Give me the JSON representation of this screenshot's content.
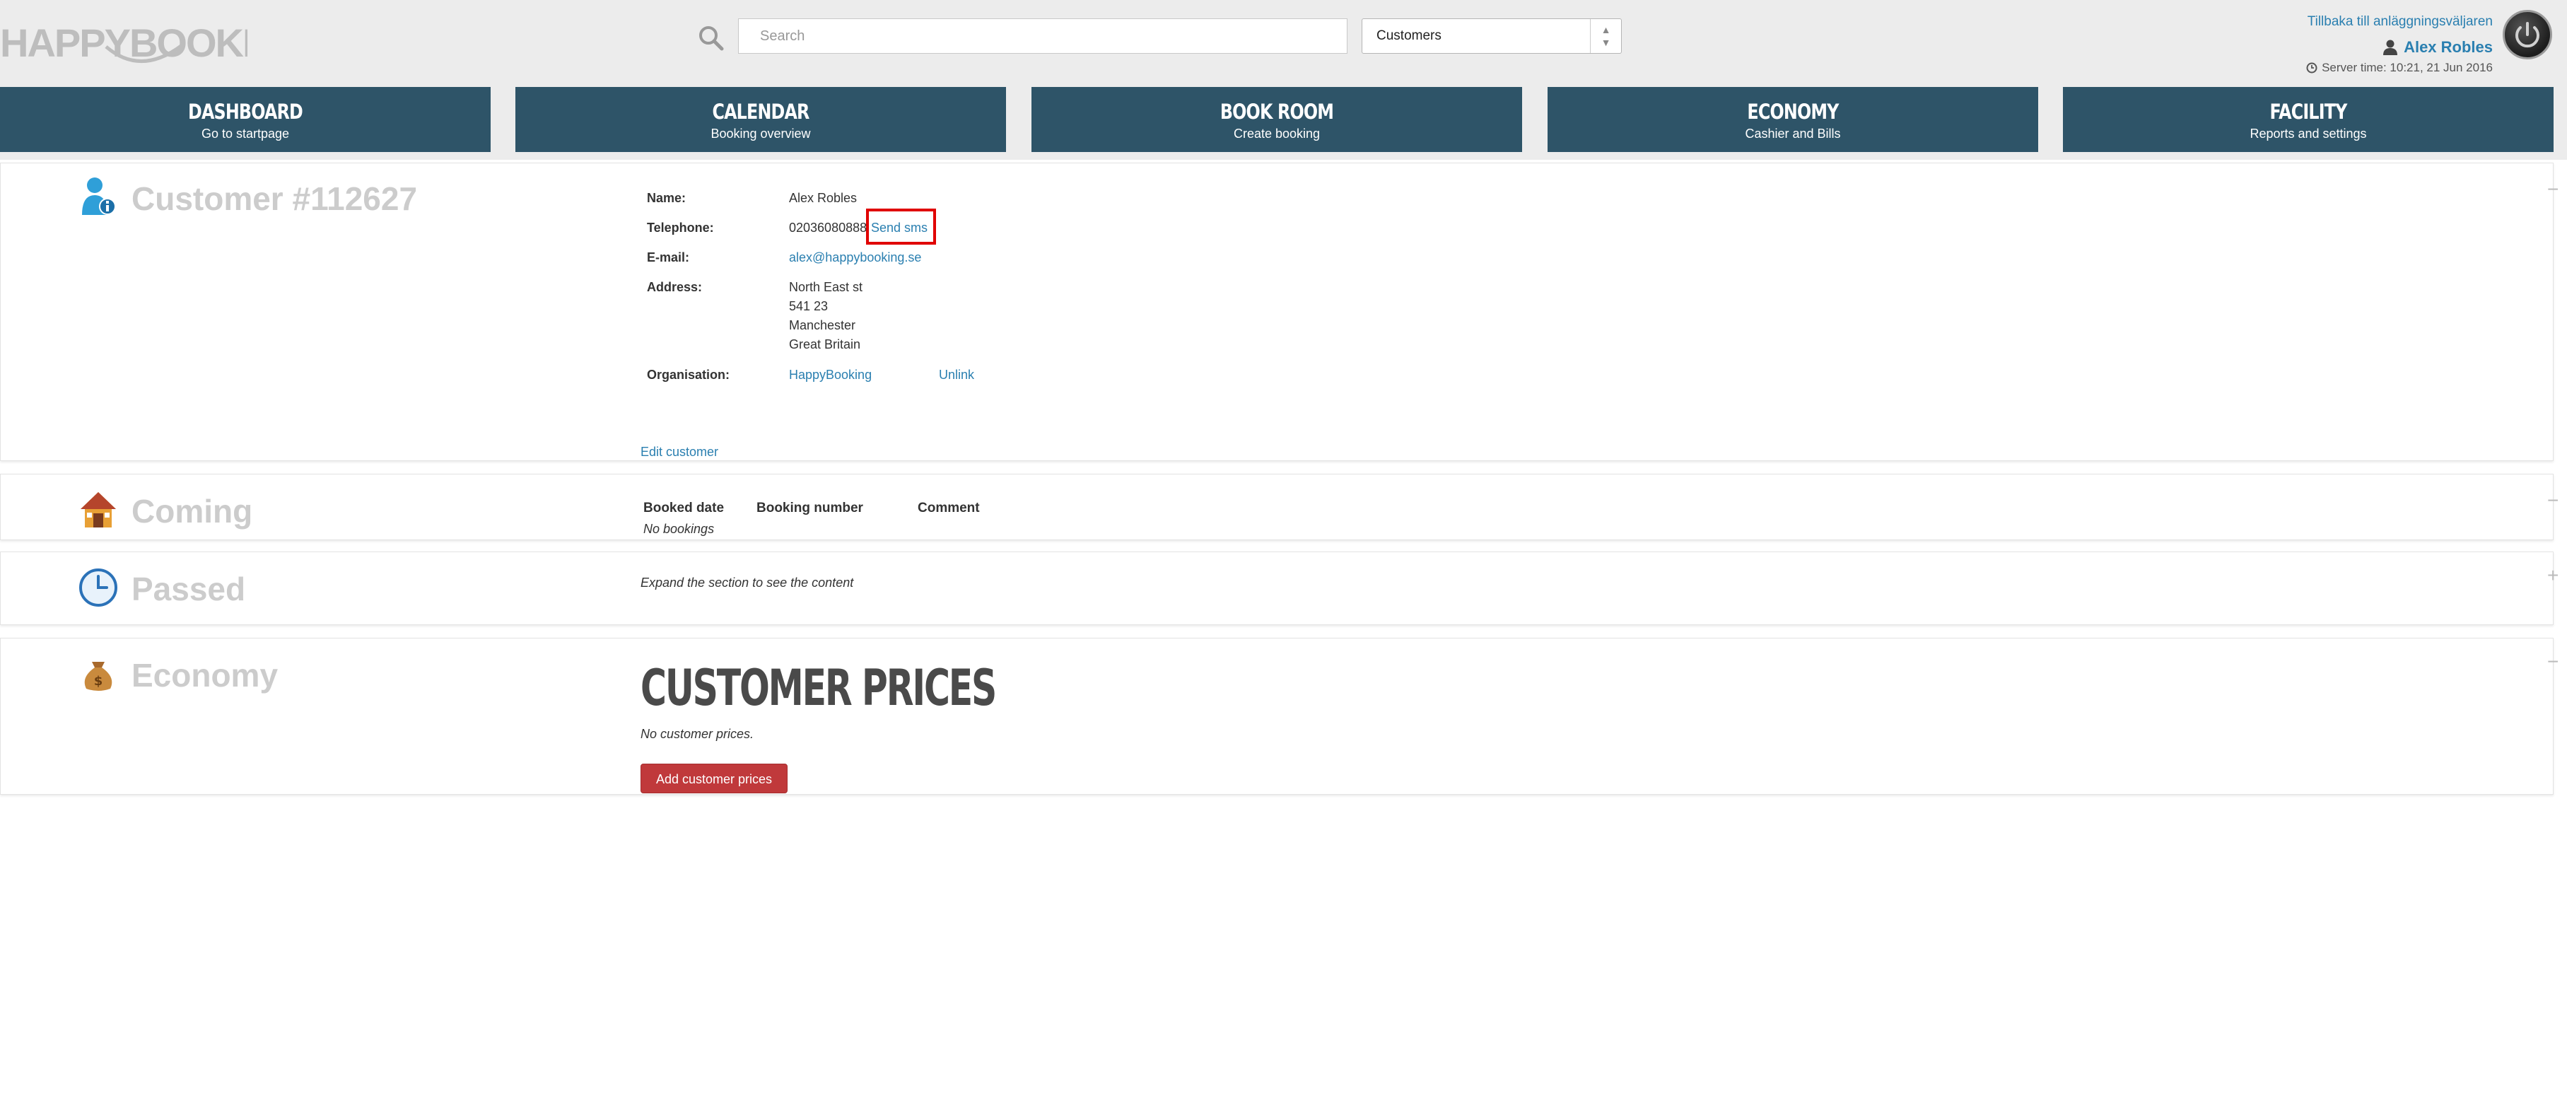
{
  "header": {
    "logo_text": "HAPPYBOOKING",
    "search": {
      "placeholder": "Search",
      "value": ""
    },
    "select": {
      "value": "Customers"
    },
    "back_link": "Tillbaka till anläggningsväljaren",
    "user_name": "Alex Robles",
    "server_time": "Server time: 10:21, 21 Jun 2016"
  },
  "nav": [
    {
      "title": "DASHBOARD",
      "subtitle": "Go to startpage"
    },
    {
      "title": "CALENDAR",
      "subtitle": "Booking overview"
    },
    {
      "title": "BOOK ROOM",
      "subtitle": "Create booking"
    },
    {
      "title": "ECONOMY",
      "subtitle": "Cashier and Bills"
    },
    {
      "title": "FACILITY",
      "subtitle": "Reports and settings"
    }
  ],
  "customer": {
    "title": "Customer #112627",
    "labels": {
      "name": "Name:",
      "telephone": "Telephone:",
      "email": "E-mail:",
      "address": "Address:",
      "organisation": "Organisation:"
    },
    "name": "Alex Robles",
    "telephone": "02036080888",
    "send_sms": "Send sms",
    "email": "alex@happybooking.se",
    "address": [
      "North East st",
      "541 23",
      "Manchester",
      "Great Britain"
    ],
    "organisation": "HappyBooking",
    "unlink": "Unlink",
    "edit": "Edit customer",
    "toggle": "−"
  },
  "coming": {
    "title": "Coming",
    "columns": [
      "Booked date",
      "Booking number",
      "Comment"
    ],
    "empty": "No bookings",
    "toggle": "−"
  },
  "passed": {
    "title": "Passed",
    "hint": "Expand the section to see the content",
    "toggle": "+"
  },
  "economy": {
    "title": "Economy",
    "heading": "CUSTOMER PRICES",
    "empty": "No customer prices.",
    "button": "Add customer prices",
    "toggle": "−"
  },
  "colors": {
    "nav_bg": "#2e5468",
    "link": "#2a7fb0",
    "highlight": "#e00000",
    "button": "#c0393b"
  }
}
